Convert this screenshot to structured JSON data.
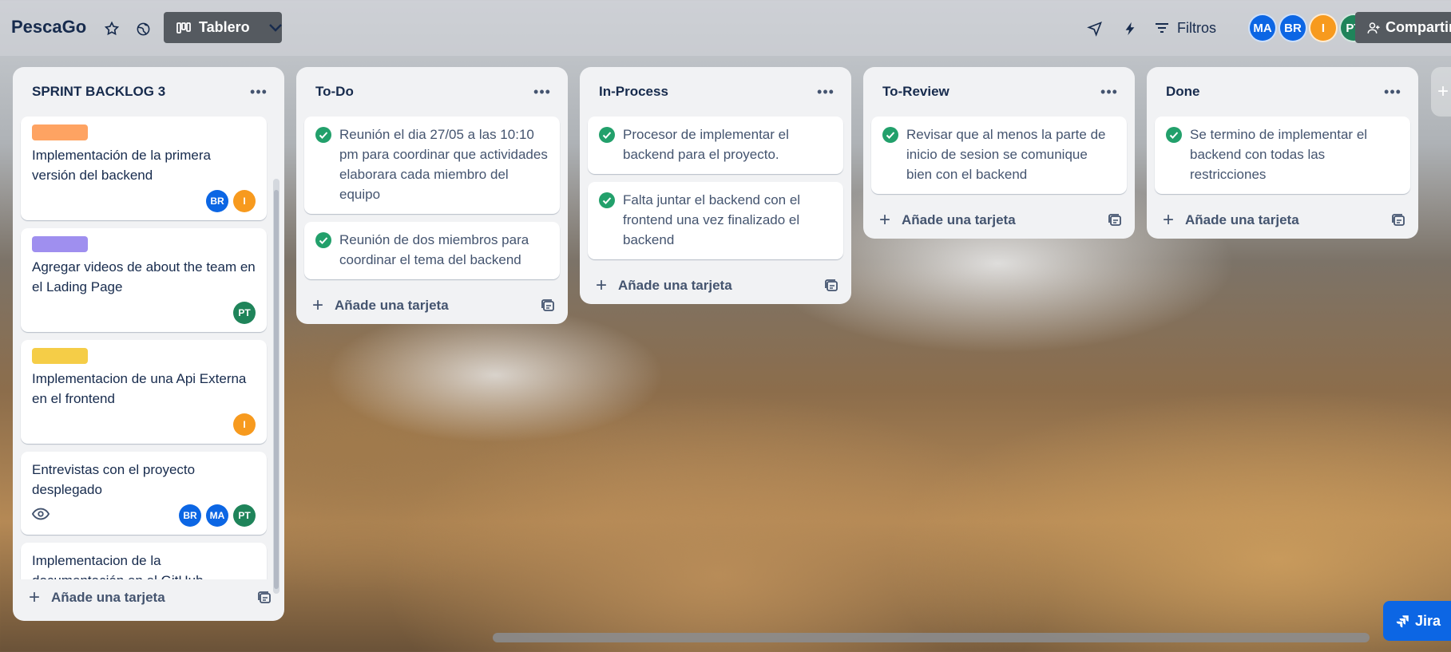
{
  "topbar": {
    "board_title": "PescaGo",
    "view_label": "Tablero",
    "filter_label": "Filtros",
    "share_label": "Compartir",
    "members": [
      {
        "initials": "MA",
        "color": "#0c66e4"
      },
      {
        "initials": "BR",
        "color": "#0c66e4"
      },
      {
        "initials": "I",
        "color": "#f79a1e"
      },
      {
        "initials": "PT",
        "color": "#1f845a"
      }
    ]
  },
  "colors": {
    "label_orange": "#fea362",
    "label_purple": "#9f8fef",
    "label_yellow": "#f5cd47",
    "check_green": "#22a06b",
    "avatar_blue": "#0c66e4",
    "avatar_orange": "#f79a1e",
    "avatar_green": "#1f845a"
  },
  "add_card_label": "Añade una tarjeta",
  "lists": [
    {
      "title": "SPRINT BACKLOG 3",
      "cards": [
        {
          "title": "Implementación de la primera versión del backend",
          "members": [
            "BR",
            "I"
          ]
        },
        {
          "title": "Agregar videos de about the team en el Lading Page",
          "members": [
            "PT"
          ]
        },
        {
          "title": "Implementacion de una Api Externa en el frontend",
          "members": [
            "I"
          ]
        },
        {
          "title": "Entrevistas con el proyecto desplegado",
          "members": [
            "BR",
            "MA",
            "PT"
          ]
        },
        {
          "title": "Implementacion de la documentación en el GitHub"
        }
      ]
    },
    {
      "title": "To-Do",
      "cards": [
        {
          "title": "Reunión el dia 27/05 a las 10:10 pm para coordinar que actividades elaborara cada miembro del equipo"
        },
        {
          "title": "Reunión de dos miembros para coordinar el tema del backend"
        }
      ]
    },
    {
      "title": "In-Process",
      "cards": [
        {
          "title": "Procesor de implementar el backend para el proyecto."
        },
        {
          "title": "Falta juntar el backend con el frontend una vez finalizado el backend"
        }
      ]
    },
    {
      "title": "To-Review",
      "cards": [
        {
          "title": "Revisar que al menos la parte de inicio de sesion se comunique bien con el backend"
        }
      ]
    },
    {
      "title": "Done",
      "cards": [
        {
          "title": "Se termino de implementar el backend con todas las restricciones"
        }
      ]
    }
  ],
  "jira_label": "Jira"
}
